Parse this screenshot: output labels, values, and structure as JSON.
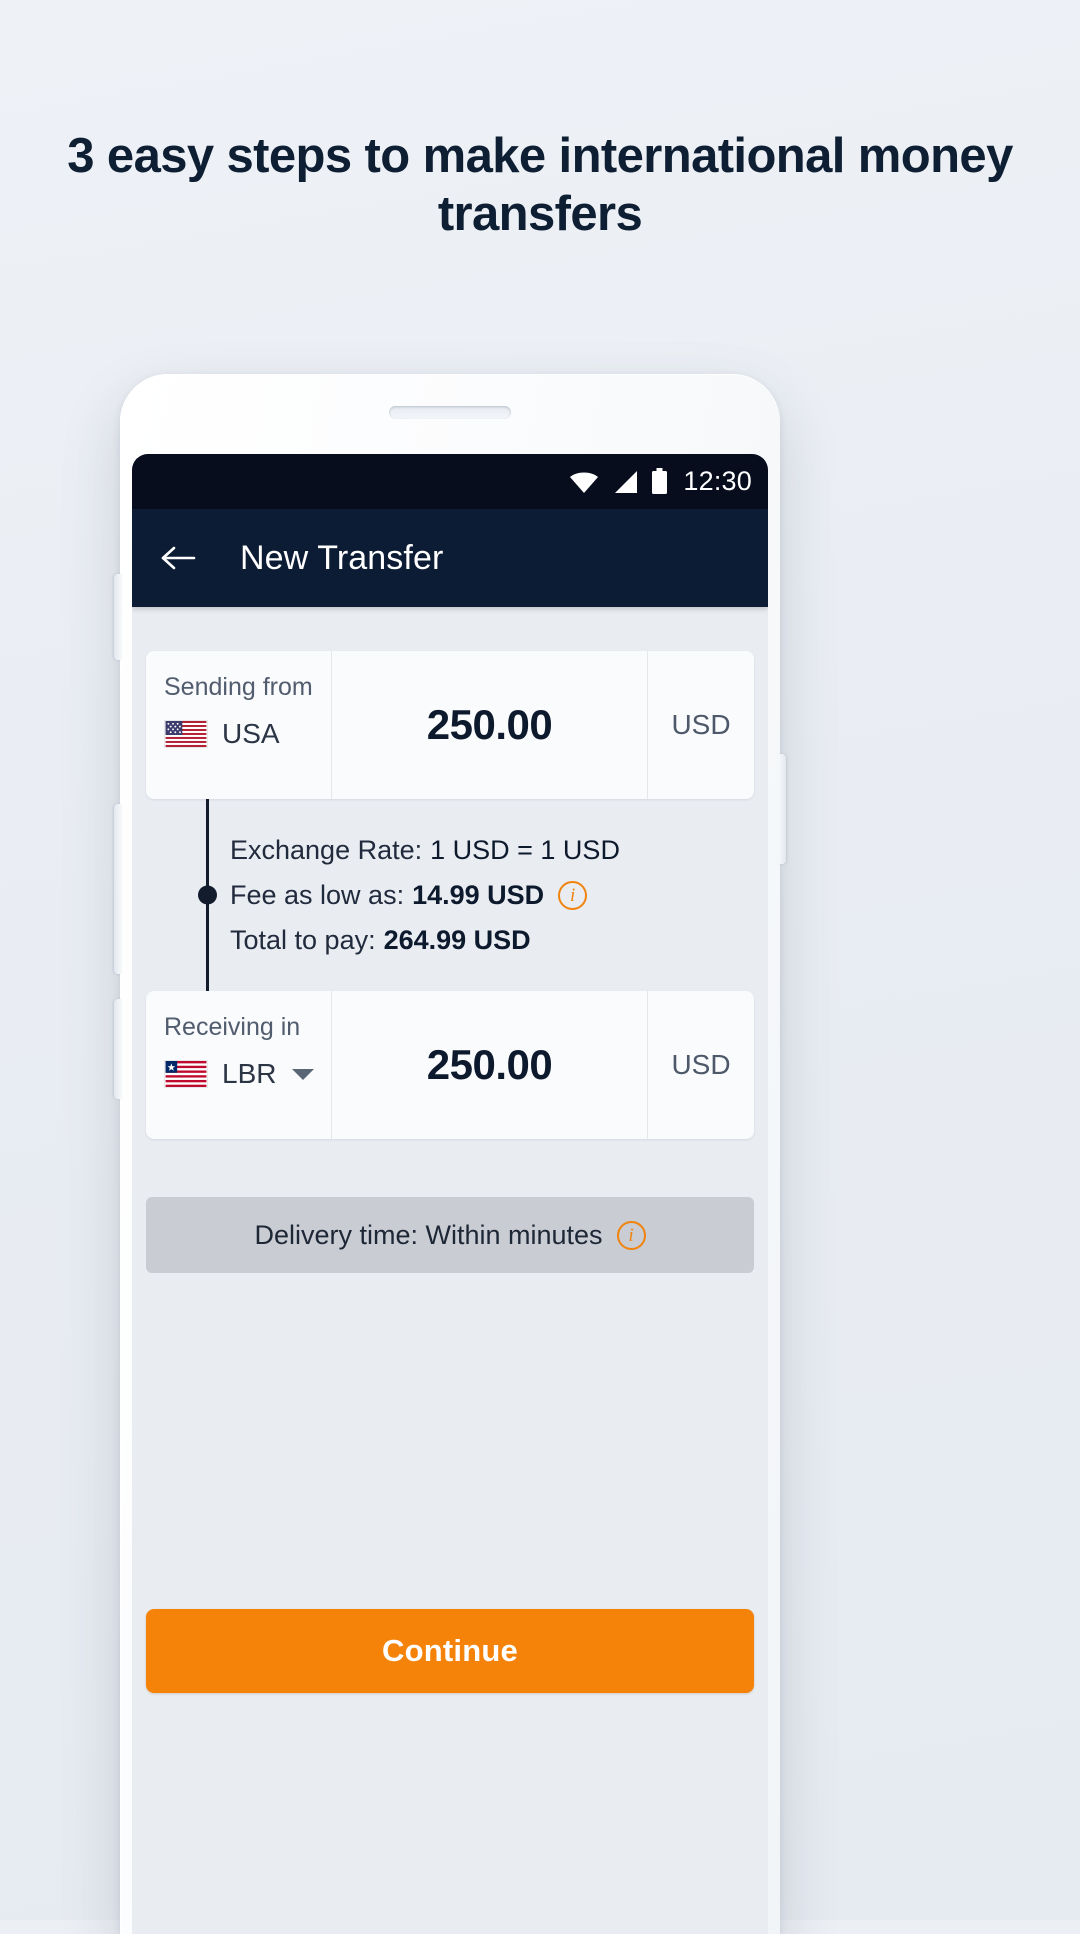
{
  "headline": "3 easy steps to make international money transfers",
  "colors": {
    "page_background": "#eceff4",
    "headline_text": "#0e1e33",
    "appbar": "#0d1c35",
    "statusbar": "#070d1c",
    "accent_orange": "#f5830a",
    "info_orange": "#f0840f",
    "delivery_bar": "#c9ccd2",
    "card": "#fafbfc"
  },
  "phone": {
    "status_bar": {
      "wifi_icon": "wifi-icon",
      "signal_icon": "signal-icon",
      "battery_icon": "battery-icon",
      "time": "12:30"
    },
    "app_bar": {
      "back_icon": "back-arrow-icon",
      "title": "New Transfer"
    },
    "send_card": {
      "label": "Sending from",
      "flag_icon": "flag-usa-icon",
      "country": "USA",
      "amount": "250.00",
      "currency": "USD"
    },
    "details": {
      "exchange_rate": {
        "label": "Exchange Rate:",
        "value": "1 USD = 1 USD"
      },
      "fee": {
        "label": "Fee as low as:",
        "value": "14.99 USD",
        "info_icon": "info-icon"
      },
      "total": {
        "label": "Total to pay:",
        "value": "264.99 USD"
      }
    },
    "receive_card": {
      "label": "Receiving in",
      "flag_icon": "flag-liberia-icon",
      "country": "LBR",
      "dropdown_icon": "chevron-down-icon",
      "amount": "250.00",
      "currency": "USD"
    },
    "delivery": {
      "text": "Delivery time: Within minutes",
      "info_icon": "info-icon"
    },
    "continue_button": {
      "label": "Continue"
    }
  }
}
